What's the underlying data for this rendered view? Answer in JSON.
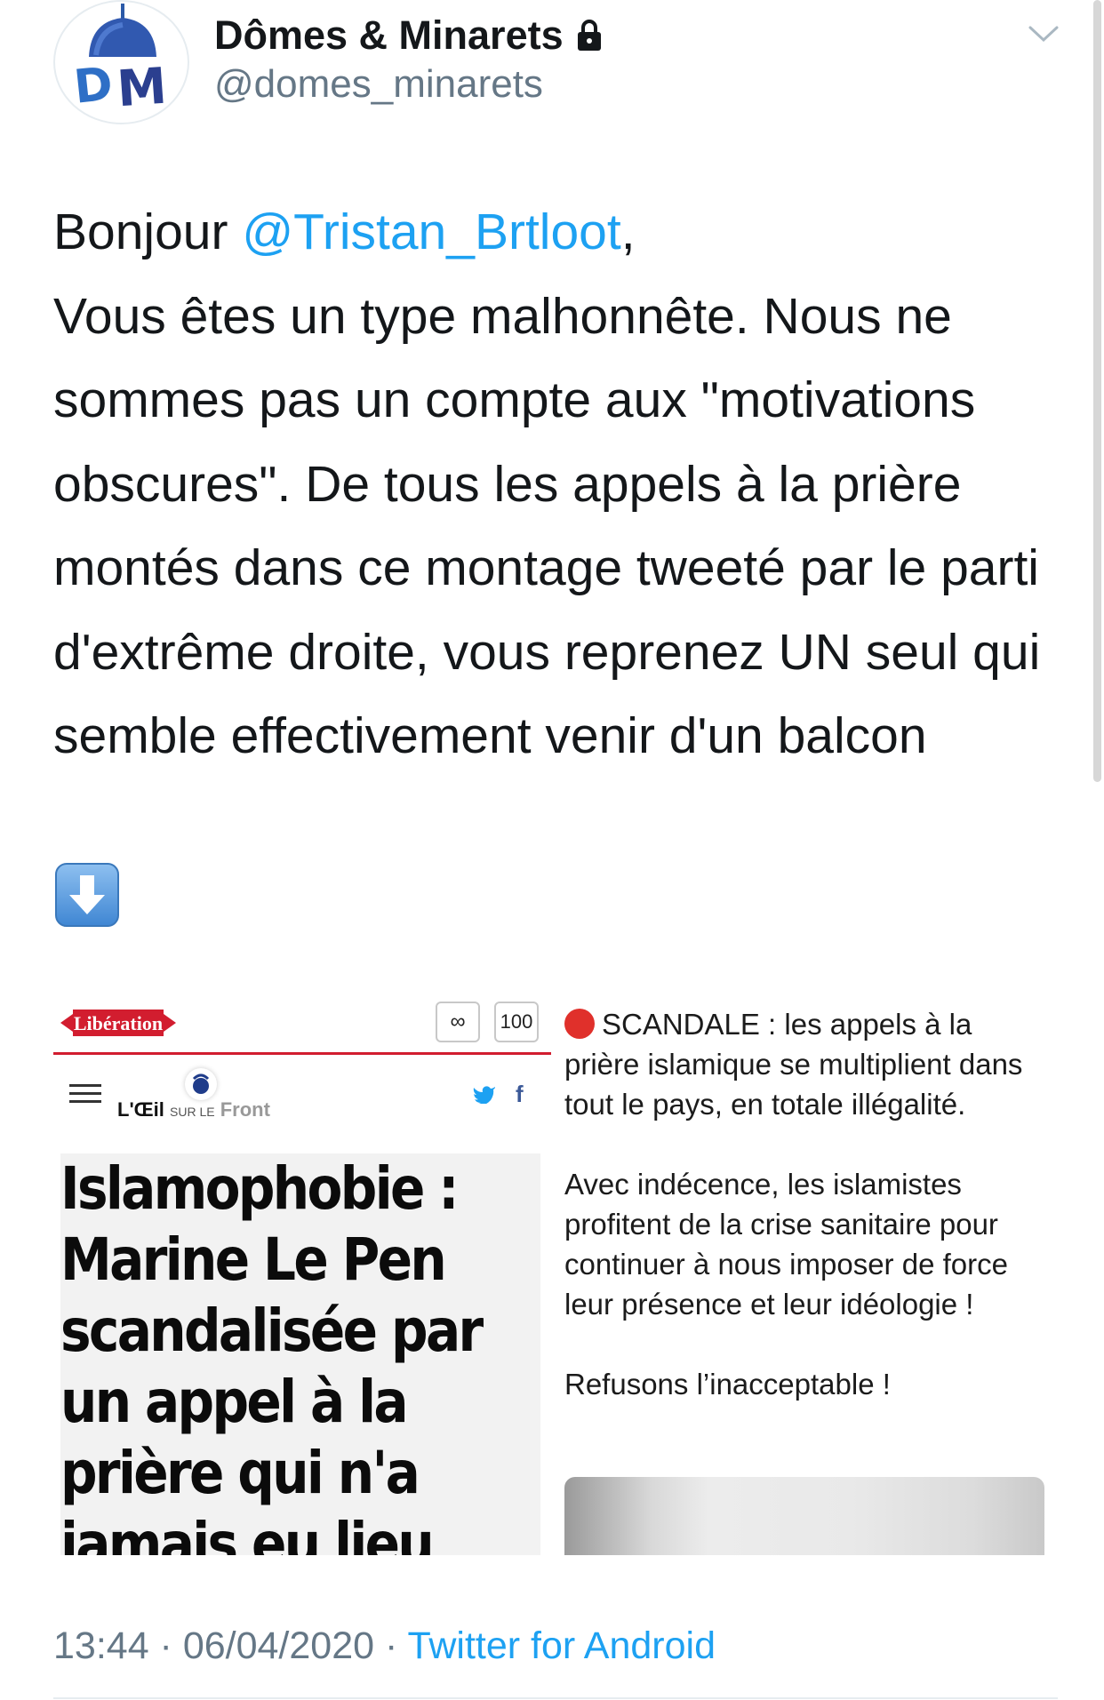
{
  "account": {
    "display_name": "Dômes & Minarets",
    "handle": "@domes_minarets",
    "avatar_letters": "DM",
    "protected_icon": "lock-icon",
    "menu_icon": "chevron-down-icon"
  },
  "tweet": {
    "greeting": "Bonjour ",
    "mention": "@Tristan_Brtloot",
    "comma": ",",
    "body": "Vous êtes un type malhonnête. Nous ne sommes pas un compte aux \"motivations obscures\". De tous les appels à la prière montés dans ce montage tweeté par le parti d'extrême droite, vous reprenez UN seul qui semble effectivement venir d'un balcon",
    "emoji_icon": "down-arrow-icon",
    "timestamp": "13:44 · 06/04/2020 · ",
    "source": "Twitter for Android"
  },
  "media": {
    "left": {
      "logo_text": "Libération",
      "share_glyph": "∞",
      "count": "100",
      "oeil_brand": "L'Œil",
      "oeil_small": "SUR LE",
      "oeil_front": "Front",
      "headline_lines": [
        "Islamophobie :",
        "Marine Le Pen",
        "scandalisée par",
        "un appel à la",
        "prière qui n'a",
        "jamais eu lieu"
      ]
    },
    "right": {
      "para1": "SCANDALE : les appels à la prière islamique se multiplient dans tout le pays, en totale illégalité.",
      "para2": "Avec indécence, les islamistes profitent de la crise sanitaire pour continuer à nous imposer de force leur présence et leur idéologie !",
      "para3": "Refusons l’inacceptable !"
    }
  },
  "colors": {
    "link": "#1da1f2",
    "text": "#14171a",
    "secondary": "#657786",
    "liberation_red": "#d21d2f",
    "avatar_blue": "#2b5aa8"
  }
}
